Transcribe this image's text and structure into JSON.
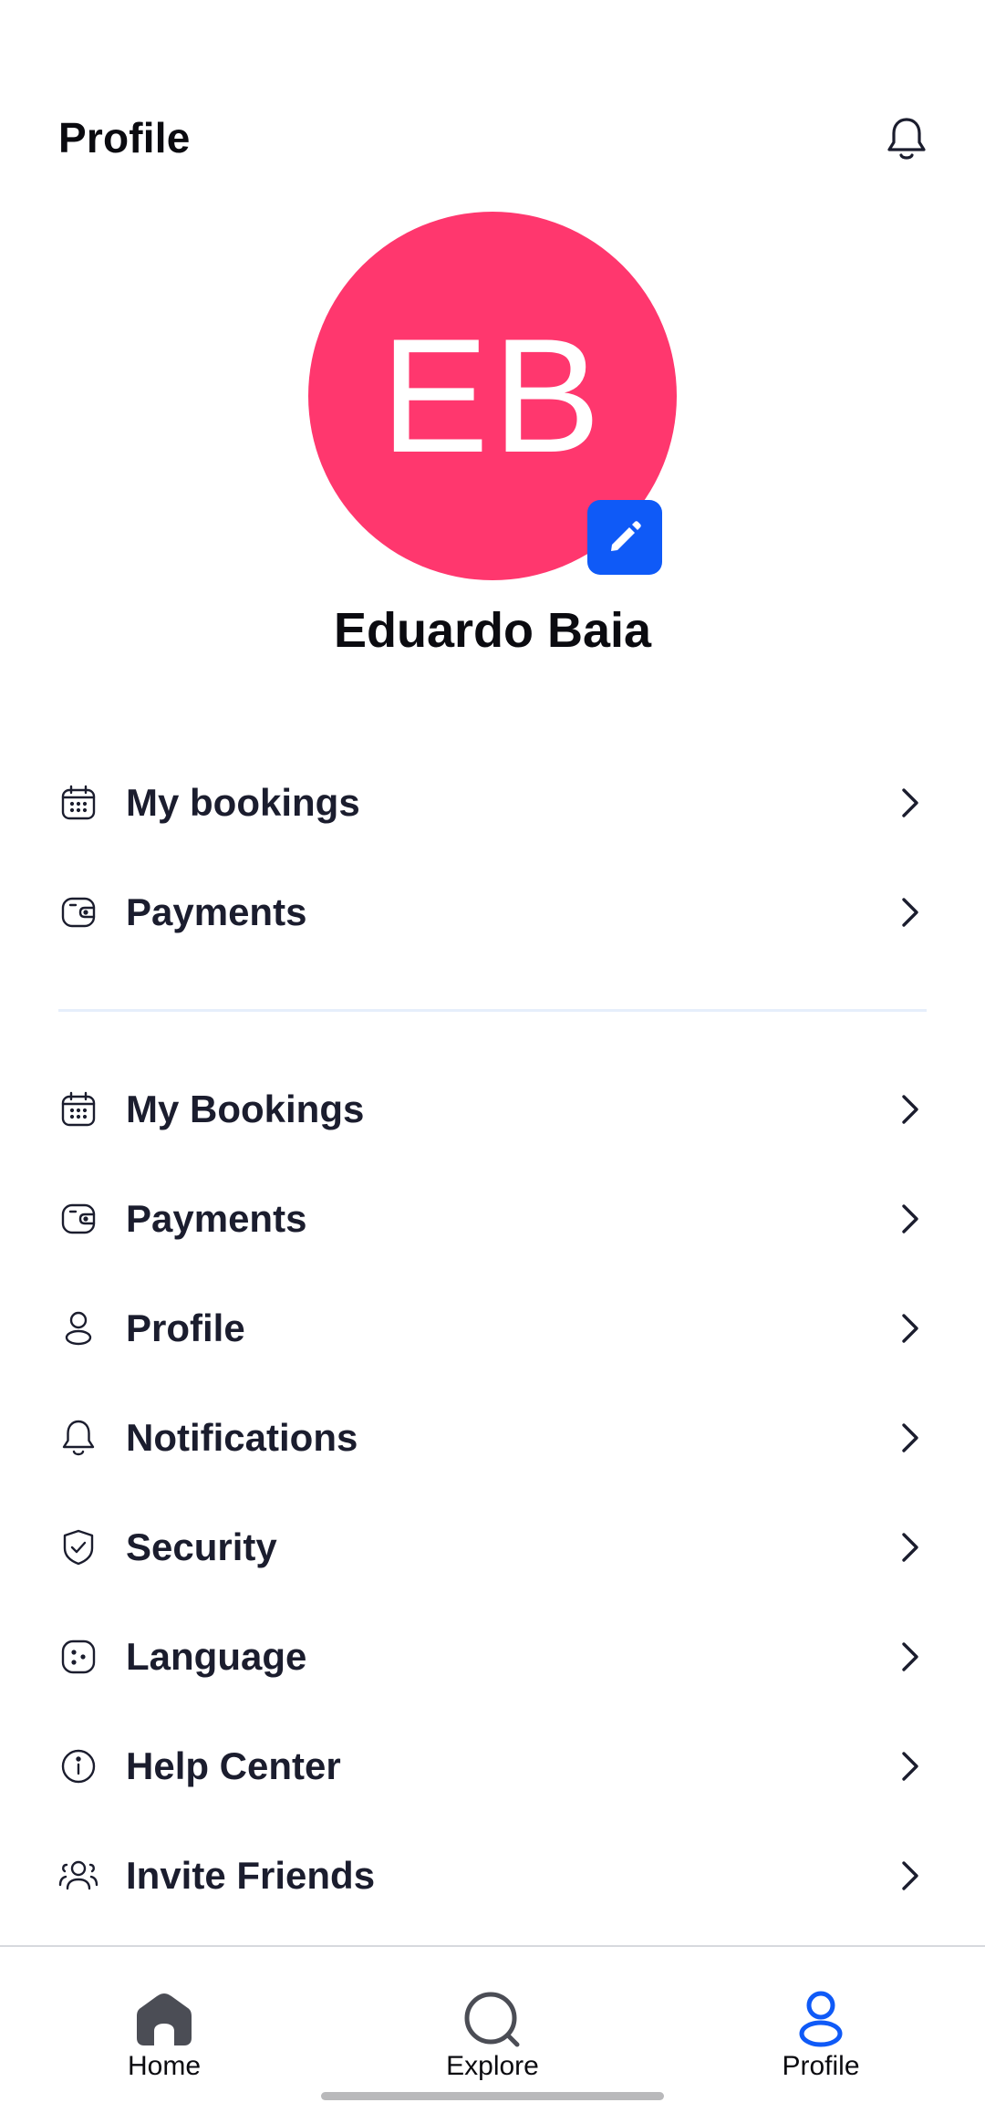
{
  "header": {
    "title": "Profile",
    "bell_icon": "bell-icon"
  },
  "profile": {
    "initials": "EB",
    "name": "Eduardo Baia",
    "avatar_color": "#ff376e",
    "edit_icon": "pencil-icon",
    "edit_color": "#0f5af7"
  },
  "menu_primary": [
    {
      "label": "My bookings",
      "icon": "calendar-icon"
    },
    {
      "label": "Payments",
      "icon": "wallet-icon"
    }
  ],
  "menu_secondary": [
    {
      "label": "My Bookings",
      "icon": "calendar-icon"
    },
    {
      "label": "Payments",
      "icon": "wallet-icon"
    },
    {
      "label": "Profile",
      "icon": "user-icon"
    },
    {
      "label": "Notifications",
      "icon": "bell-icon"
    },
    {
      "label": "Security",
      "icon": "shield-check-icon"
    },
    {
      "label": "Language",
      "icon": "language-icon"
    },
    {
      "label": "Help Center",
      "icon": "info-icon"
    },
    {
      "label": "Invite Friends",
      "icon": "users-icon"
    }
  ],
  "bottom_nav": [
    {
      "label": "Home",
      "icon": "home-icon",
      "active": false
    },
    {
      "label": "Explore",
      "icon": "search-icon",
      "active": false
    },
    {
      "label": "Profile",
      "icon": "user-icon",
      "active": true
    }
  ],
  "colors": {
    "accent": "#0f5af7",
    "text": "#1b1d2e",
    "divider": "#e6eefb"
  }
}
